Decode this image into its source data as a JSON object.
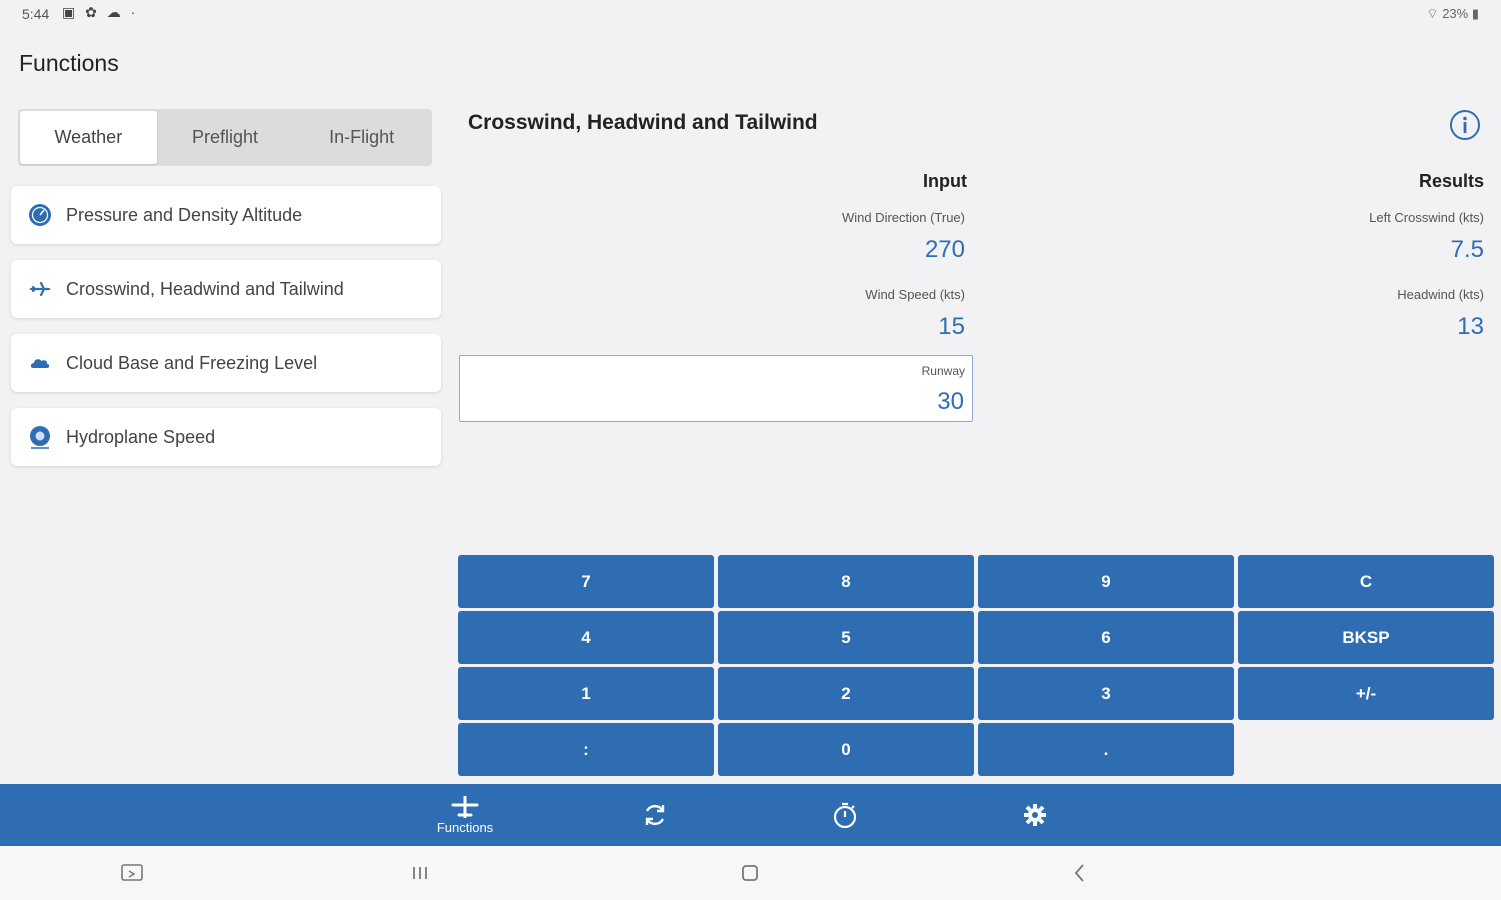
{
  "status_bar": {
    "time": "5:44",
    "icons": [
      "gallery-icon",
      "gear-icon",
      "cloud-icon",
      "dot-icon"
    ],
    "battery": "23%",
    "wifi_icon": "wifi-icon"
  },
  "sidebar": {
    "title": "Functions",
    "tabs": [
      {
        "label": "Weather",
        "active": true
      },
      {
        "label": "Preflight",
        "active": false
      },
      {
        "label": "In-Flight",
        "active": false
      }
    ],
    "items": [
      {
        "label": "Pressure and Density Altitude",
        "icon": "gauge-icon"
      },
      {
        "label": "Crosswind, Headwind and Tailwind",
        "icon": "airplane-icon"
      },
      {
        "label": "Cloud Base and Freezing Level",
        "icon": "cloud-icon"
      },
      {
        "label": "Hydroplane Speed",
        "icon": "wheel-icon"
      }
    ]
  },
  "calculator": {
    "title": "Crosswind, Headwind and Tailwind",
    "info_icon": "info-icon",
    "input": {
      "heading": "Input",
      "wind_direction_label": "Wind Direction (True)",
      "wind_direction_value": "270",
      "wind_speed_label": "Wind Speed (kts)",
      "wind_speed_value": "15",
      "runway_label": "Runway",
      "runway_value": "30"
    },
    "results": {
      "heading": "Results",
      "crosswind_label": "Left Crosswind (kts)",
      "crosswind_value": "7.5",
      "headwind_label": "Headwind (kts)",
      "headwind_value": "13"
    }
  },
  "keypad": {
    "keys": [
      "7",
      "8",
      "9",
      "C",
      "4",
      "5",
      "6",
      "BKSP",
      "1",
      "2",
      "3",
      "+/-",
      ":",
      "0",
      "."
    ]
  },
  "bottom_nav": {
    "items": [
      {
        "label": "Functions",
        "icon": "airplane-icon"
      },
      {
        "label": "",
        "icon": "refresh-icon"
      },
      {
        "label": "",
        "icon": "timer-icon"
      },
      {
        "label": "",
        "icon": "gear-icon"
      }
    ]
  },
  "colors": {
    "accent": "#2f6db3",
    "background": "#f2f1f4"
  }
}
